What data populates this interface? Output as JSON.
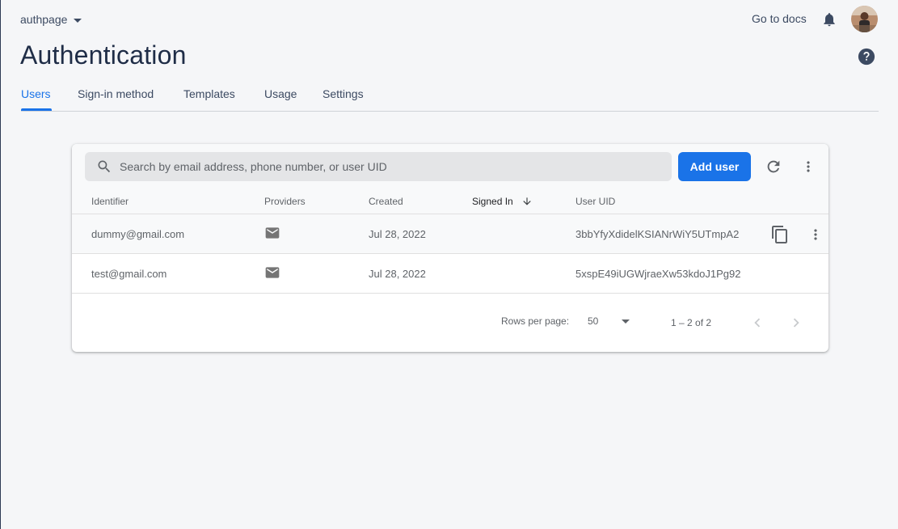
{
  "header": {
    "project": "authpage",
    "docs_link": "Go to docs"
  },
  "page": {
    "title": "Authentication",
    "tabs": [
      {
        "label": "Users",
        "active": true
      },
      {
        "label": "Sign-in method",
        "active": false
      },
      {
        "label": "Templates",
        "active": false
      },
      {
        "label": "Usage",
        "active": false
      },
      {
        "label": "Settings",
        "active": false
      }
    ]
  },
  "users_table": {
    "search_placeholder": "Search by email address, phone number, or user UID",
    "add_user_label": "Add user",
    "columns": [
      "Identifier",
      "Providers",
      "Created",
      "Signed In",
      "User UID"
    ],
    "sort_column": "Signed In",
    "rows": [
      {
        "identifier": "dummy@gmail.com",
        "provider": "email-icon",
        "created": "Jul 28, 2022",
        "signed_in": "",
        "uid": "3bbYfyXdidelKSIANrWiY5UTmpA2"
      },
      {
        "identifier": "test@gmail.com",
        "provider": "email-icon",
        "created": "Jul 28, 2022",
        "signed_in": "",
        "uid": "5xspE49iUGWjraeXw53kdoJ1Pg92"
      }
    ],
    "pagination": {
      "rows_per_page_label": "Rows per page:",
      "rows_per_page": "50",
      "range": "1 – 2 of 2"
    }
  },
  "colors": {
    "accent": "#1a73e8",
    "title": "#1f2d47",
    "background": "#f5f6f8"
  }
}
